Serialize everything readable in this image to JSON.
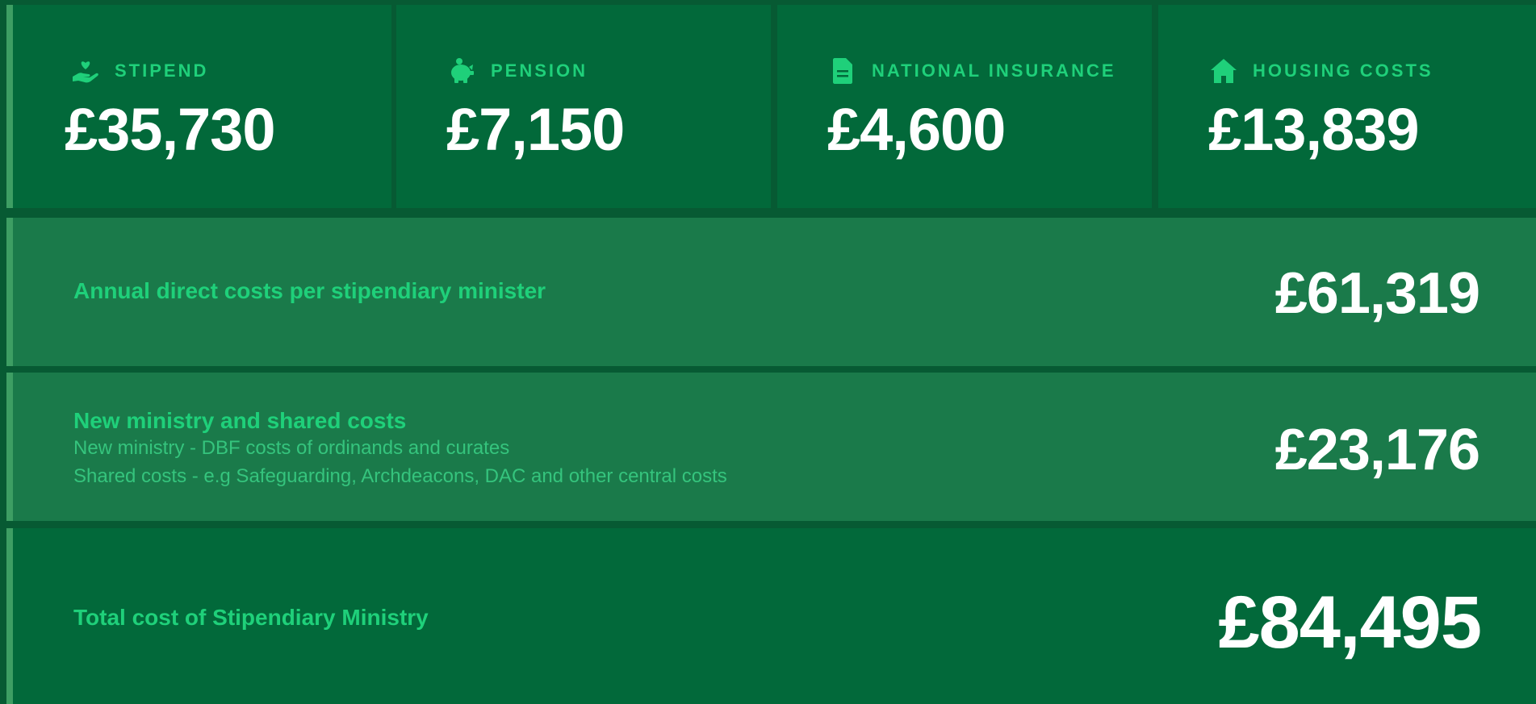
{
  "cards": [
    {
      "label": "STIPEND",
      "value": "£35,730",
      "icon": "hand-heart-icon"
    },
    {
      "label": "PENSION",
      "value": "£7,150",
      "icon": "piggy-bank-icon"
    },
    {
      "label": "NATIONAL INSURANCE",
      "value": "£4,600",
      "icon": "document-icon"
    },
    {
      "label": "HOUSING COSTS",
      "value": "£13,839",
      "icon": "house-icon"
    }
  ],
  "direct_costs": {
    "label": "Annual direct costs per stipendiary minister",
    "value": "£61,319"
  },
  "new_ministry": {
    "title": "New ministry and shared costs",
    "line1": "New ministry - DBF costs of ordinands and curates",
    "line2": "Shared costs - e.g Safeguarding, Archdeacons, DAC and other central costs",
    "value": "£23,176"
  },
  "total": {
    "label": "Total cost of Stipendiary Ministry",
    "value": "£84,495"
  },
  "colors": {
    "background": "#075a33",
    "card": "#02693a",
    "row_light": "#1a7a4a",
    "accent_text": "#1fd07a",
    "value_text": "#ffffff"
  }
}
